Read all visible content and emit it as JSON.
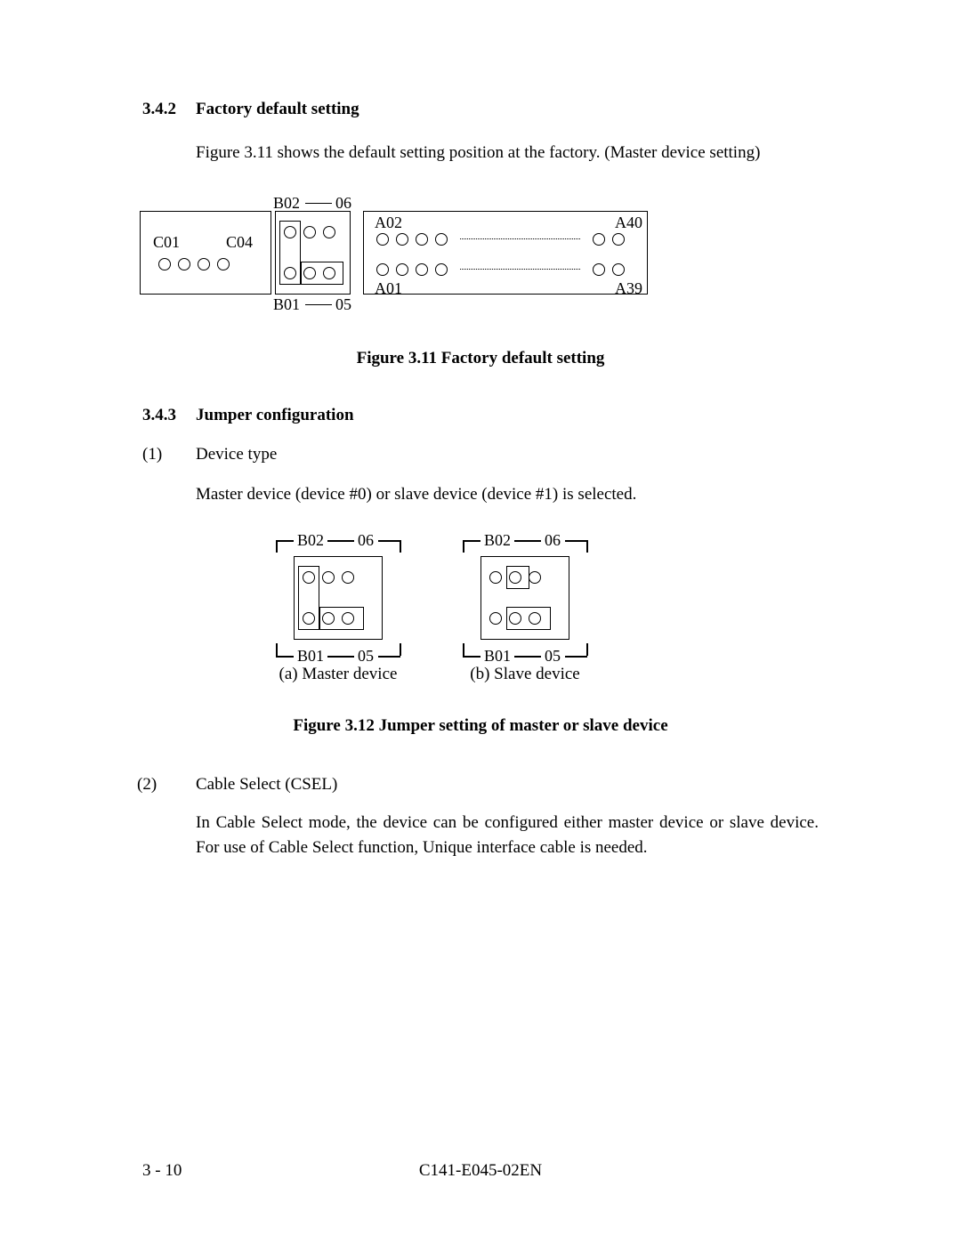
{
  "s342": {
    "num": "3.4.2",
    "title": "Factory default setting"
  },
  "p342": "Figure 3.11 shows the default setting position at the factory. (Master device setting)",
  "fig311": {
    "caption": "Figure 3.11  Factory default setting",
    "labels": {
      "C01": "C01",
      "C04": "C04",
      "B02": "B02",
      "B06": "06",
      "B01": "B01",
      "B05": "05",
      "A02": "A02",
      "A40": "A40",
      "A01": "A01",
      "A39": "A39"
    }
  },
  "s343": {
    "num": "3.4.3",
    "title": "Jumper configuration"
  },
  "item1": {
    "marker": "(1)",
    "title": "Device type"
  },
  "p_item1": "Master device (device #0) or slave device (device #1) is selected.",
  "fig312": {
    "caption": "Figure 3.12  Jumper setting of master or slave device",
    "left_caption": "(a)  Master device",
    "right_caption": "(b)  Slave device",
    "labels": {
      "B02": "B02",
      "B06": "06",
      "B01": "B01",
      "B05": "05"
    }
  },
  "item2": {
    "marker": "(2)",
    "title": "Cable Select (CSEL)"
  },
  "p_item2": "In Cable Select mode, the device can be configured either master device or slave device. For use of Cable Select function, Unique interface cable is needed.",
  "footer": {
    "page": "3 - 10",
    "doc": "C141-E045-02EN"
  }
}
